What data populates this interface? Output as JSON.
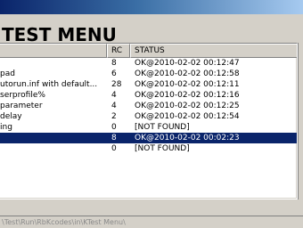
{
  "window": {
    "title": "TEST MENU"
  },
  "table": {
    "columns": [
      "",
      "RC",
      "STATUS"
    ],
    "rows": [
      {
        "name": "",
        "rc": "8",
        "status": "OK@2010-02-02 00:12:47"
      },
      {
        "name": "pad",
        "rc": "6",
        "status": "OK@2010-02-02 00:12:58"
      },
      {
        "name": "utorun.inf with default...",
        "rc": "28",
        "status": "OK@2010-02-02 00:12:11"
      },
      {
        "name": "serprofile%",
        "rc": "4",
        "status": "OK@2010-02-02 00:12:16"
      },
      {
        "name": "parameter",
        "rc": "4",
        "status": "OK@2010-02-02 00:12:25"
      },
      {
        "name": "delay",
        "rc": "2",
        "status": "OK@2010-02-02 00:12:54"
      },
      {
        "name": "ing",
        "rc": "0",
        "status": "[NOT FOUND]"
      },
      {
        "name": "",
        "rc": "8",
        "status": "OK@2010-02-02 00:02:23",
        "selected": true
      },
      {
        "name": "",
        "rc": "0",
        "status": "[NOT FOUND]"
      }
    ]
  },
  "statusbar": {
    "path": "\\Test\\Run\\RbKcodes\\in\\KTest Menu\\"
  }
}
